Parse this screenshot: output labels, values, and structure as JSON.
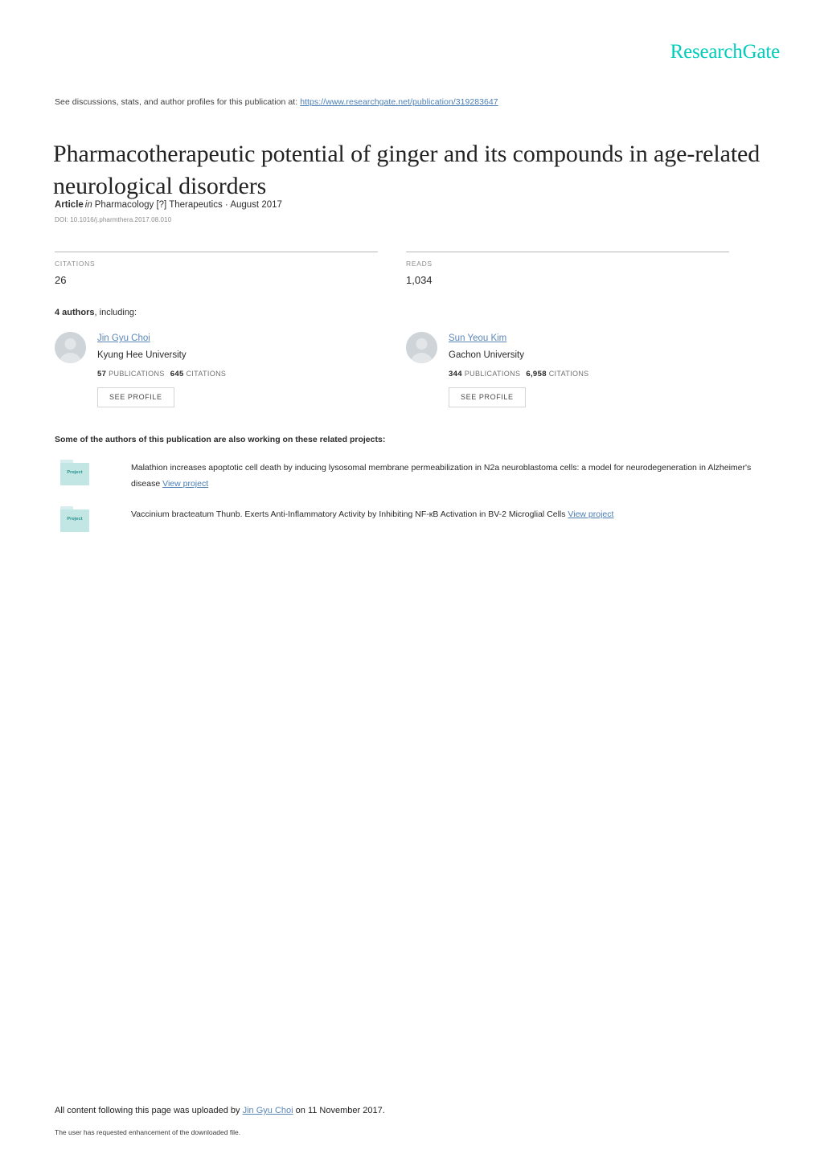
{
  "brand": {
    "logo_text": "ResearchGate",
    "logo_color": "#00ccbb",
    "link_color": "#4a7eb5"
  },
  "header": {
    "discussions_prefix": "See discussions, stats, and author profiles for this publication at:",
    "publication_url": "https://www.researchgate.net/publication/319283647"
  },
  "publication": {
    "title": "Pharmacotherapeutic potential of ginger and its compounds in age-related neurological disorders",
    "type_label": "Article",
    "in_label": "in",
    "journal": "Pharmacology [?] Therapeutics",
    "date_separator": "·",
    "date": "August 2017",
    "doi_label": "DOI:",
    "doi": "10.1016/j.pharmthera.2017.08.010"
  },
  "stats": {
    "citations_label": "CITATIONS",
    "citations_value": "26",
    "reads_label": "READS",
    "reads_value": "1,034"
  },
  "authors_section": {
    "count_text": "4 authors",
    "intro_suffix": ", including:",
    "avatar_icon": "user-avatar-icon",
    "see_profile_label": "SEE PROFILE",
    "publications_label": "PUBLICATIONS",
    "citations_label": "CITATIONS",
    "authors": [
      {
        "name": "Jin Gyu Choi",
        "affiliation": "Kyung Hee University",
        "publications": "57",
        "citations": "645"
      },
      {
        "name": "Sun Yeou Kim",
        "affiliation": "Gachon University",
        "publications": "344",
        "citations": "6,958"
      }
    ]
  },
  "projects_section": {
    "intro": "Some of the authors of this publication are also working on these related projects:",
    "icon_label": "Project",
    "view_project_label": "View project",
    "projects": [
      {
        "title": "Malathion increases apoptotic cell death by inducing lysosomal membrane permeabilization in N2a neuroblastoma cells: a model for neurodegeneration in Alzheimer's disease"
      },
      {
        "title": "Vaccinium bracteatum Thunb. Exerts Anti-Inflammatory Activity by Inhibiting NF-кB Activation in BV-2 Microglial Cells"
      }
    ]
  },
  "footer": {
    "upload_prefix": "All content following this page was uploaded by",
    "uploader_name": "Jin Gyu Choi",
    "upload_suffix": "on 11 November 2017.",
    "enhancement_note": "The user has requested enhancement of the downloaded file."
  }
}
